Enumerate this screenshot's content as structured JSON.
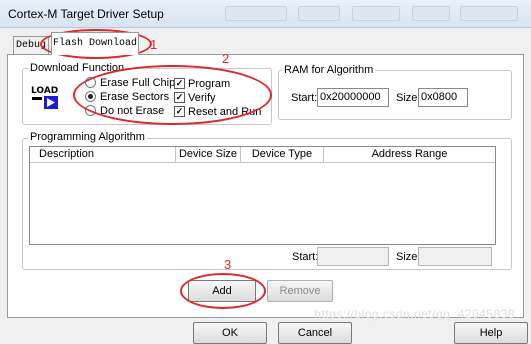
{
  "window": {
    "title": "Cortex-M Target Driver Setup"
  },
  "tabs": [
    {
      "label": "Debug",
      "active": false
    },
    {
      "label": "Flash Download",
      "active": true
    }
  ],
  "download_function": {
    "group_label": "Download Function",
    "icon_text": "LOAD",
    "erase_options": [
      {
        "label": "Erase Full Chip",
        "selected": false
      },
      {
        "label": "Erase Sectors",
        "selected": true
      },
      {
        "label": "Do not Erase",
        "selected": false
      }
    ],
    "checks": [
      {
        "label": "Program",
        "checked": true
      },
      {
        "label": "Verify",
        "checked": true
      },
      {
        "label": "Reset and Run",
        "checked": true
      }
    ]
  },
  "ram": {
    "group_label": "RAM for Algorithm",
    "start_label": "Start:",
    "start_value": "0x20000000",
    "size_label": "Size:",
    "size_value": "0x0800"
  },
  "programming": {
    "group_label": "Programming Algorithm",
    "columns": [
      "Description",
      "Device Size",
      "Device Type",
      "Address Range"
    ],
    "rows": [],
    "start_label": "Start:",
    "size_label": "Size:"
  },
  "buttons": {
    "add": "Add",
    "remove": "Remove",
    "ok": "OK",
    "cancel": "Cancel",
    "help": "Help"
  },
  "annotations": [
    "1",
    "2",
    "3"
  ],
  "watermark": "https://blog.csdn.net/qq_42045838",
  "colors": {
    "annotation": "#e02828"
  }
}
